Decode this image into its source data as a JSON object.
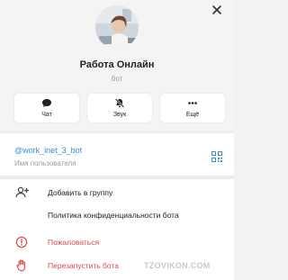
{
  "profile": {
    "name": "Работа Онлайн",
    "type": "бот"
  },
  "actions": [
    {
      "label": "Чат",
      "icon": "chat-bubble-icon"
    },
    {
      "label": "Звук",
      "icon": "bell-muted-icon"
    },
    {
      "label": "Ещё",
      "icon": "more-dots-icon"
    }
  ],
  "user_info": {
    "username": "@work_inet_3_bot",
    "caption": "Имя пользователя",
    "qr_icon": "qr-code-icon"
  },
  "menu": {
    "add_to_group": "Добавить в группу",
    "privacy_policy": "Политика конфиденциальности бота",
    "report": "Пожаловаться",
    "restart": "Перезапустить бота"
  },
  "watermark": "TZOVIKON.COM",
  "colors": {
    "accent": "#3a8ed6",
    "danger": "#d84b4b",
    "background": "#f2f2f2"
  }
}
